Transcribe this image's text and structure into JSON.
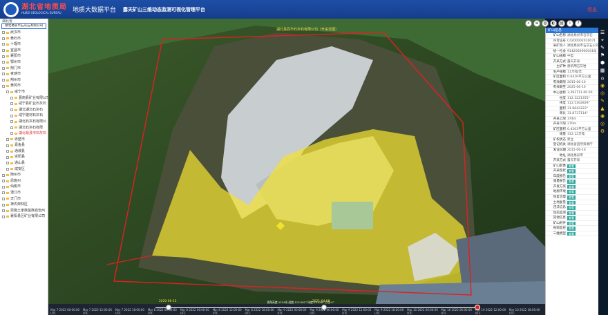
{
  "header": {
    "brand_cn": "湖北省地质局",
    "brand_en": "HUBEI GEOLOGICAL BUREAU",
    "platform": "地质大数据平台",
    "subtitle": "露天矿山三维动态监测可视化管理平台",
    "logout": "退出"
  },
  "left_panel": {
    "top_label": "湖北省",
    "search_value": "湖北易县市石灰石有限公司",
    "items": [
      {
        "label": "武汉市",
        "level": 0
      },
      {
        "label": "黄石市",
        "level": 0
      },
      {
        "label": "十堰市",
        "level": 0
      },
      {
        "label": "宜昌市",
        "level": 0
      },
      {
        "label": "襄阳市",
        "level": 0
      },
      {
        "label": "鄂州市",
        "level": 0
      },
      {
        "label": "荆门市",
        "level": 0
      },
      {
        "label": "孝感市",
        "level": 0
      },
      {
        "label": "荆州市",
        "level": 0
      },
      {
        "label": "黄冈市",
        "level": 0
      },
      {
        "label": "咸宁市",
        "level": 1
      },
      {
        "label": "晋南县矿业有限公司",
        "level": 2
      },
      {
        "label": "咸宁县矿业石灰石",
        "level": 2
      },
      {
        "label": "湖北湖北石灰石",
        "level": 2
      },
      {
        "label": "咸宁建材石灰石",
        "level": 2
      },
      {
        "label": "湖北石灰石有限公",
        "level": 2
      },
      {
        "label": "湖北石灰石有限",
        "level": 2
      },
      {
        "label": "湖北易县市石灰石",
        "level": 2,
        "active": true
      },
      {
        "label": "赤壁市",
        "level": 1
      },
      {
        "label": "嘉鱼县",
        "level": 1
      },
      {
        "label": "通城县",
        "level": 1
      },
      {
        "label": "崇阳县",
        "level": 1
      },
      {
        "label": "通山县",
        "level": 1
      },
      {
        "label": "咸安区",
        "level": 1
      },
      {
        "label": "随州市",
        "level": 0
      },
      {
        "label": "恩施州",
        "level": 0
      },
      {
        "label": "仙桃市",
        "level": 0
      },
      {
        "label": "潜江市",
        "level": 0
      },
      {
        "label": "天门市",
        "level": 0
      },
      {
        "label": "神农架林区",
        "level": 0
      },
      {
        "label": "恩施土家族苗族自治州",
        "level": 0
      },
      {
        "label": "襄阳县区矿业有限公司",
        "level": 0
      }
    ]
  },
  "map": {
    "top_annotation": "湖北易县市石灰石有限公司（开采范围）",
    "timeline_dates": [
      "2020-06-15",
      "2021-04-08"
    ],
    "coord_readout": "视角高度:1234米 经度:113.562° 纬度:29.856° 方位:0°",
    "timeline_labels": [
      "Mar 7 2022 00:00:00 UTC",
      "Mar 7 2022 12:00:00 UTC",
      "Mar 7 2022 18:00:00 UTC",
      "Mar 8 2022 00:00:00 UTC",
      "Mar 8 2022 06:00:00 UTC",
      "Mar 8 2022 12:00:00 UTC",
      "Mar 8 2022 18:00:00 UTC",
      "Mar 9 2022 00:00:00 UTC",
      "Mar 9 2022 06:00:00 UTC",
      "Mar 9 2022 12:00:00 UTC",
      "Mar 9 2022 18:00:00 UTC",
      "Mar 10 2022 00:00:00 UTC",
      "Mar 10 2022 06:00:00 UTC",
      "Mar 10 2022 12:00:00 UTC",
      "Mar 10 2022 18:00:00 UTC"
    ]
  },
  "toolbar": {
    "icons": [
      "search-icon",
      "layers-icon",
      "globe-icon",
      "palette-icon",
      "chart-icon",
      "info-icon",
      "help-icon"
    ]
  },
  "attributes": {
    "title": "矿山信息",
    "rows": [
      {
        "k": "矿山名称",
        "v": "湖北易县市石灰石"
      },
      {
        "k": "许可证号",
        "v": "C4200002010071"
      },
      {
        "k": "采矿权人",
        "v": "湖北易县市石灰石公司"
      },
      {
        "k": "统一社会",
        "v": "91420600000418J"
      },
      {
        "k": "矿山规模",
        "v": "中型"
      },
      {
        "k": "开采方式",
        "v": "露天开采"
      },
      {
        "k": "主矿种",
        "v": "建筑用石灰岩"
      },
      {
        "k": "生产规模",
        "v": "11万吨/年"
      },
      {
        "k": "矿区面积",
        "v": "0.6416平方公里"
      },
      {
        "k": "有效期限",
        "v": "2015-06-10"
      },
      {
        "k": "有效期至",
        "v": "2025-06-10"
      },
      {
        "k": "中心坐标",
        "v": "3,392711.00.00"
      },
      {
        "k": "经度",
        "v": "112.3221355°"
      },
      {
        "k": "纬度",
        "v": "112.5302829°"
      },
      {
        "k": "面积",
        "v": "31.8642222°"
      },
      {
        "k": "周长",
        "v": "31.8737114°"
      },
      {
        "k": "开采上限",
        "v": "374m"
      },
      {
        "k": "开采下限",
        "v": "270m"
      },
      {
        "k": "矿区面积",
        "v": "0.4203平方公里"
      },
      {
        "k": "储量",
        "v": "312.12万吨"
      },
      {
        "k": "矿权状态",
        "v": "新立"
      },
      {
        "k": "登记机关",
        "v": "湖北省自然资源厅"
      },
      {
        "k": "发证日期",
        "v": "2015-06-10"
      },
      {
        "k": "地址",
        "v": "湖北易县市"
      },
      {
        "k": "开采方式",
        "v": "露天开采"
      }
    ],
    "button_rows": [
      {
        "k": "矿山影像",
        "b": "查看"
      },
      {
        "k": "开采现状",
        "b": "查看"
      },
      {
        "k": "年度报告",
        "b": "查看"
      },
      {
        "k": "储量报告",
        "b": "查看"
      },
      {
        "k": "开发方案",
        "b": "查看"
      },
      {
        "k": "地质环境",
        "b": "查看"
      },
      {
        "k": "恢复治理",
        "b": "查看"
      },
      {
        "k": "土地复垦",
        "b": "查看"
      },
      {
        "k": "违法信息",
        "b": "查看"
      },
      {
        "k": "动态监测",
        "b": "查看"
      },
      {
        "k": "其他信息",
        "b": "查看"
      },
      {
        "k": "矿山附件",
        "b": "查看"
      },
      {
        "k": "视频监控",
        "b": "查看"
      },
      {
        "k": "三维模型",
        "b": "查看"
      }
    ]
  },
  "colors": {
    "header": "#1d4fa8",
    "boundary": "#e02020",
    "highlight": "#f2e230",
    "button": "#2fa7a0"
  }
}
